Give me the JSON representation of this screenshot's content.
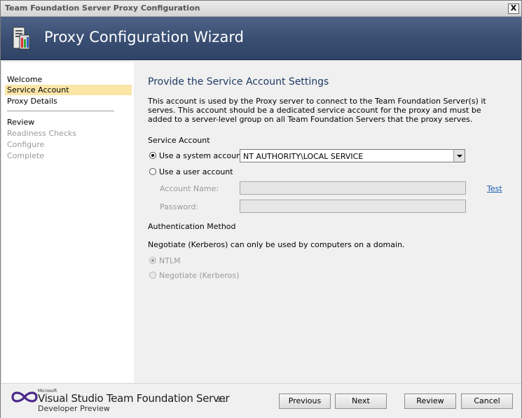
{
  "window": {
    "title": "Team Foundation Server Proxy Configuration",
    "close_label": "X"
  },
  "banner": {
    "title": "Proxy Configuration Wizard",
    "icon": "server-config-icon"
  },
  "nav": {
    "items": [
      {
        "label": "Welcome",
        "state": "normal"
      },
      {
        "label": "Service Account",
        "state": "selected"
      },
      {
        "label": "Proxy Details",
        "state": "normal"
      },
      {
        "label": "Review",
        "state": "normal"
      },
      {
        "label": "Readiness Checks",
        "state": "disabled"
      },
      {
        "label": "Configure",
        "state": "disabled"
      },
      {
        "label": "Complete",
        "state": "disabled"
      }
    ]
  },
  "main": {
    "heading": "Provide the Service Account Settings",
    "intro": "This account is used by the Proxy server to connect to the Team Foundation Server(s) it serves. This account should be a dedicated service account for the proxy and must be added to a server-level group on all Team Foundation Servers that the proxy serves.",
    "service_account": {
      "heading": "Service Account",
      "system_label": "Use a system account:",
      "system_value": "NT AUTHORITY\\LOCAL SERVICE",
      "user_label": "Use a user account",
      "account_name_label": "Account Name:",
      "account_name_value": "",
      "password_label": "Password:",
      "password_value": "",
      "test_label": "Test"
    },
    "auth": {
      "heading": "Authentication Method",
      "note": "Negotiate (Kerberos) can only be used by computers on a domain.",
      "ntlm_label": "NTLM",
      "kerberos_label": "Negotiate (Kerberos)"
    }
  },
  "footer": {
    "brand_small": "Microsoft",
    "brand_title": "Visual Studio Team Foundation Server",
    "brand_version": "11",
    "brand_sub": "Developer Preview",
    "buttons": {
      "previous": "Previous",
      "next": "Next",
      "review": "Review",
      "cancel": "Cancel"
    }
  }
}
